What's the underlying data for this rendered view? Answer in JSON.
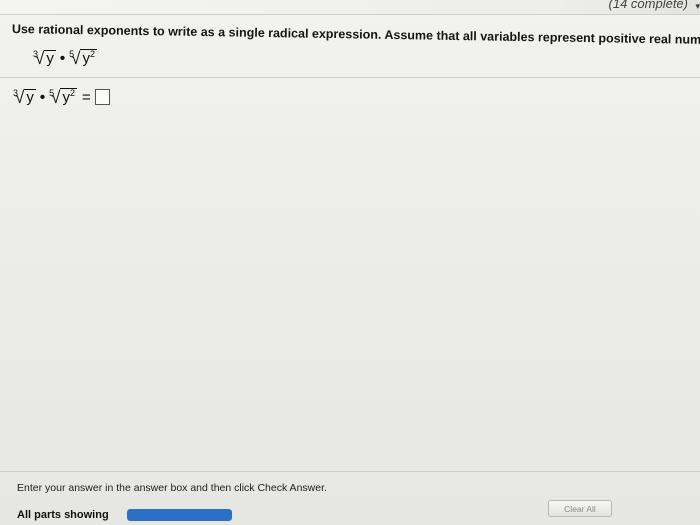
{
  "header": {
    "progress_text": "(14 complete)",
    "dropdown_caret": "▾"
  },
  "question": {
    "instruction": "Use rational exponents to write as a single radical expression. Assume that all variables represent positive real numbers.",
    "expression": {
      "first_index": "3",
      "first_radicand": "y",
      "operator": "•",
      "second_index": "5",
      "second_radicand_base": "y",
      "second_radicand_exponent": "2"
    },
    "equals": "="
  },
  "answer": {
    "value": ""
  },
  "footer": {
    "note": "Enter your answer in the answer box and then click Check Answer.",
    "parts_label": "All parts showing",
    "parts_progress": 1.0,
    "clear_all_label": "Clear All"
  },
  "colors": {
    "progress_fill": "#2c6fc4"
  }
}
